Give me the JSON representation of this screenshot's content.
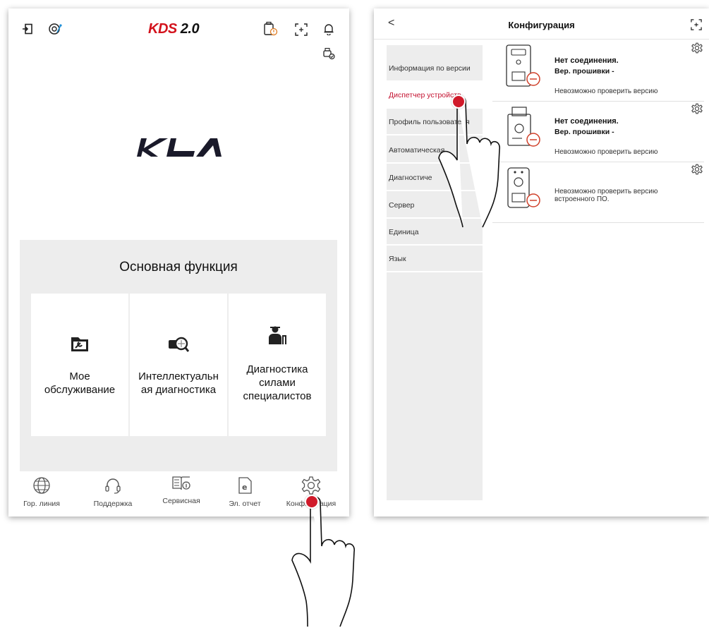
{
  "left": {
    "brand": {
      "kds_red": "KDS",
      "kds_version": "2.0"
    },
    "car_brand": "KIA",
    "main": {
      "title": "Основная функция",
      "tiles": [
        {
          "icon": "folder-wrench-icon",
          "label": "Мое обслуживание"
        },
        {
          "icon": "engine-search-icon",
          "label": "Интеллектуальн ая диагностика"
        },
        {
          "icon": "technician-tools-icon",
          "label": "Диагностика силами специалистов"
        }
      ]
    },
    "nav": [
      {
        "icon": "globe-icon",
        "label": "Гор. линия"
      },
      {
        "icon": "headset-icon",
        "label": "Поддержка"
      },
      {
        "icon": "service-book-icon",
        "label": "Сервисная"
      },
      {
        "icon": "e-report-icon",
        "label": "Эл. отчет"
      },
      {
        "icon": "gear-icon",
        "label": "Конфигурация"
      }
    ]
  },
  "right": {
    "header": {
      "back": "<",
      "title": "Конфигурация"
    },
    "sidebar": [
      {
        "label": "Информация по версии",
        "active": false
      },
      {
        "label": "Диспетчер устройств",
        "active": true
      },
      {
        "label": "Профиль пользователя",
        "active": false
      },
      {
        "label": "Автоматическая",
        "active": false
      },
      {
        "label": "Диагностиче",
        "active": false
      },
      {
        "label": "Сервер",
        "active": false
      },
      {
        "label": "Единица",
        "active": false
      },
      {
        "label": "Язык",
        "active": false
      }
    ],
    "devices": [
      {
        "status": "Нет соединения.",
        "firmware": "Вер. прошивки -",
        "note": "Невозможно проверить версию"
      },
      {
        "status": "Нет соединения.",
        "firmware": "Вер. прошивки -",
        "note": "Невозможно проверить версию"
      },
      {
        "status": "",
        "firmware": "",
        "note": "Невозможно проверить версию встроенного ПО."
      }
    ]
  },
  "colors": {
    "accent": "#c41230",
    "tap": "#d01a2a",
    "panel": "#ededed"
  }
}
